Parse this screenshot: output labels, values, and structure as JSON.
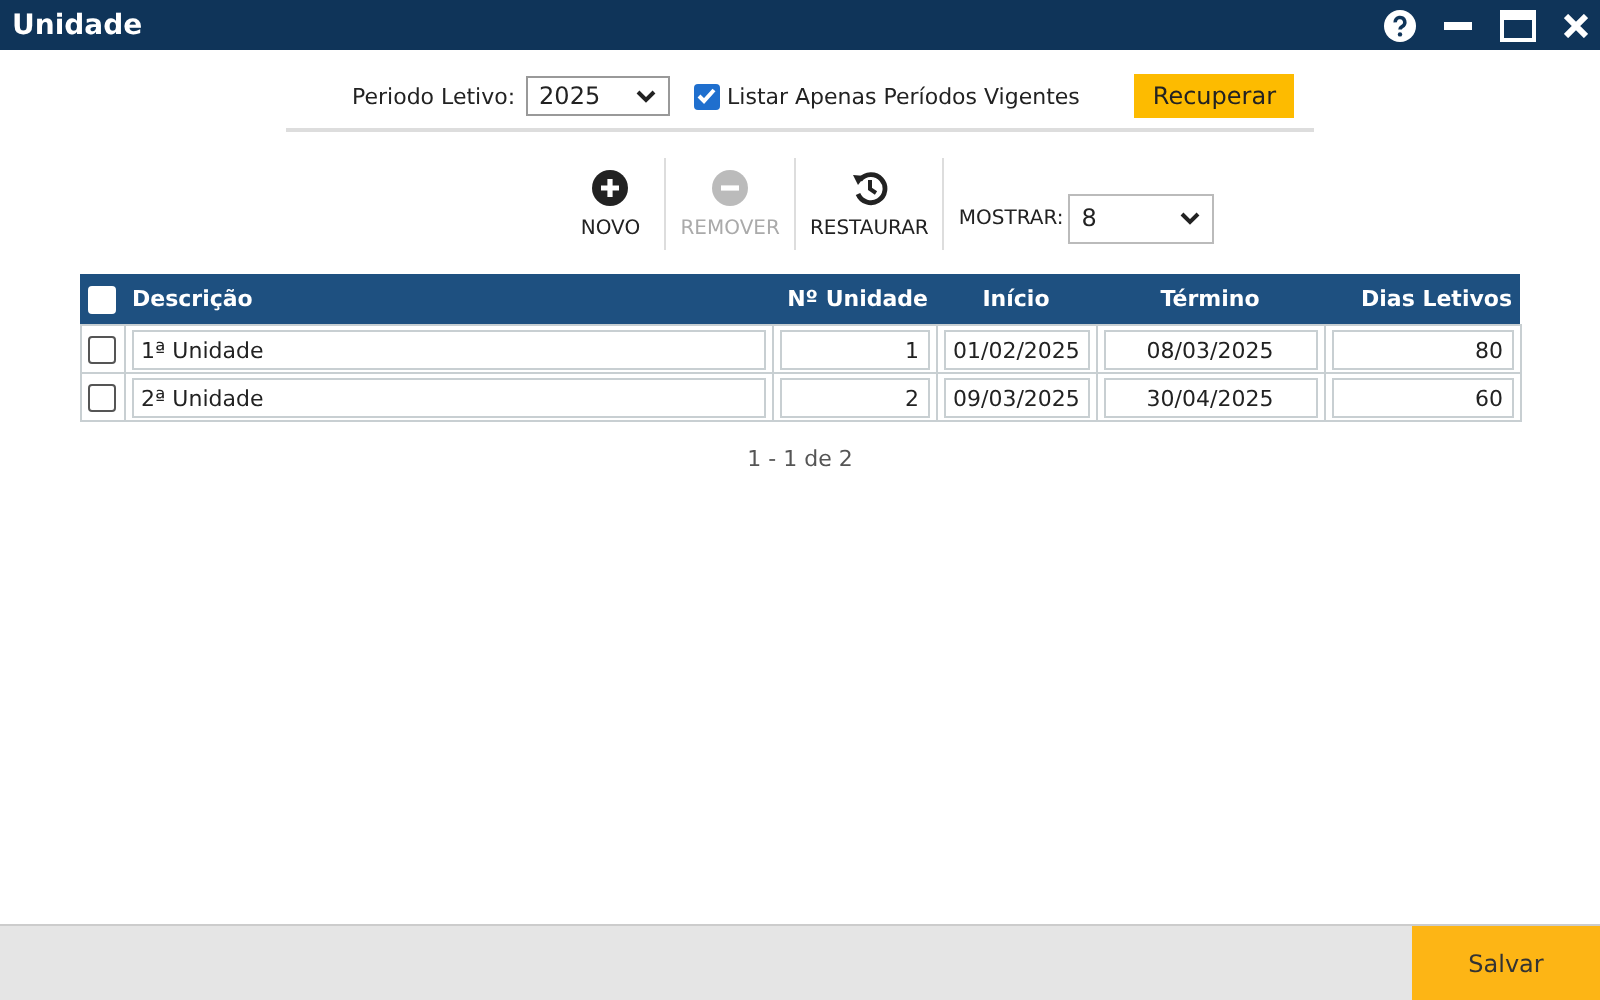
{
  "window": {
    "title": "Unidade"
  },
  "filter": {
    "period_label": "Periodo Letivo:",
    "period_value": "2025",
    "only_current": {
      "label": "Listar Apenas Períodos Vigentes",
      "checked": true
    },
    "fetch_button": "Recuperar"
  },
  "toolbar": {
    "actions": [
      {
        "kind": "add",
        "label": "NOVO",
        "disabled": false
      },
      {
        "kind": "remove",
        "label": "REMOVER",
        "disabled": true
      },
      {
        "kind": "restore",
        "label": "RESTAURAR",
        "disabled": false
      }
    ],
    "show_label": "MOSTRAR:",
    "show_value": "8"
  },
  "table": {
    "all_checked": false,
    "columns": [
      "Descrição",
      "Nº Unidade",
      "Início",
      "Término",
      "Dias Letivos"
    ],
    "rows": [
      {
        "checked": false,
        "cells": [
          "1ª Unidade",
          "1",
          "01/02/2025",
          "08/03/2025",
          "80"
        ]
      },
      {
        "checked": false,
        "cells": [
          "2ª Unidade",
          "2",
          "09/03/2025",
          "30/04/2025",
          "60"
        ]
      }
    ]
  },
  "pagination": "1 - 1 de 2",
  "footer": {
    "save_button": "Salvar"
  }
}
